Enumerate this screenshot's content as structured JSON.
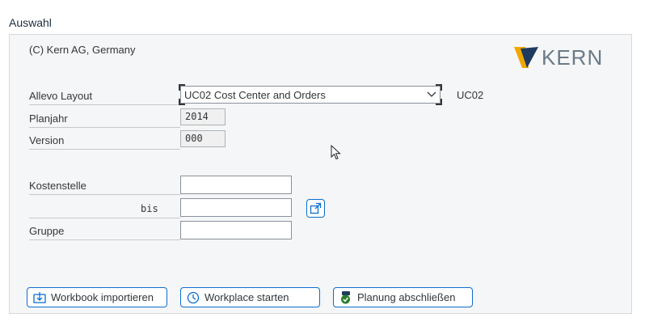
{
  "section": {
    "title": "Auswahl"
  },
  "header": {
    "copyright": "(C) Kern AG, Germany",
    "logo_text": "KERN"
  },
  "form": {
    "layout": {
      "label": "Allevo Layout",
      "value": "UC02 Cost Center and Orders",
      "code": "UC02"
    },
    "planjahr": {
      "label": "Planjahr",
      "value": "2014"
    },
    "version": {
      "label": "Version",
      "value": "000"
    },
    "kostenstelle": {
      "label": "Kostenstelle",
      "value": "",
      "to_label": "bis",
      "to_value": ""
    },
    "gruppe": {
      "label": "Gruppe",
      "value": ""
    }
  },
  "buttons": {
    "import": "Workbook importieren",
    "workplace": "Workplace starten",
    "finish": "Planung abschließen"
  },
  "colors": {
    "accent": "#0a6ed1",
    "logo_gold": "#f0a800",
    "logo_navy": "#1f3a5f",
    "check_green": "#2b7d2b"
  }
}
